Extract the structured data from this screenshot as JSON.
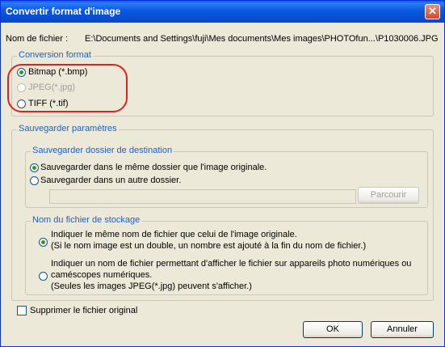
{
  "window": {
    "title": "Convertir format d'image",
    "close_symbol": "✕"
  },
  "file": {
    "label": "Nom de fichier :",
    "value": "E:\\Documents and Settings\\fuji\\Mes documents\\Mes images\\PHOTOfun...\\P1030006.JPG"
  },
  "conversion": {
    "legend": "Conversion format",
    "options": [
      {
        "label": "Bitmap (*.bmp)",
        "selected": true,
        "enabled": true
      },
      {
        "label": "JPEG(*.jpg)",
        "selected": false,
        "enabled": false
      },
      {
        "label": "TIFF (*.tif)",
        "selected": false,
        "enabled": true
      }
    ]
  },
  "save_params": {
    "legend": "Sauvegarder paramètres",
    "destination": {
      "legend": "Sauvegarder dossier de destination",
      "options": [
        {
          "label": "Sauvegarder dans le même dossier que l'image originale.",
          "selected": true
        },
        {
          "label": "Sauvegarder dans un autre dossier.",
          "selected": false
        }
      ],
      "folder_value": "",
      "browse_label": "Parcourir"
    },
    "storage_name": {
      "legend": "Nom du fichier de stockage",
      "option1_lines": [
        "Indiquer le même nom de fichier que celui de l'image originale.",
        "(Si le nom image est un double, un nombre est ajouté à la fin du nom de fichier.)"
      ],
      "option2_lines": [
        "Indiquer un nom de fichier permettant d'afficher le fichier sur appareils photo numériques ou",
        "caméscopes numériques.",
        "(Seules les images JPEG(*.jpg) peuvent s'afficher.)"
      ]
    }
  },
  "delete_original": {
    "label": "Supprimer le fichier original",
    "checked": false
  },
  "buttons": {
    "ok": "OK",
    "cancel": "Annuler"
  },
  "colors": {
    "titlebar": "#0a58e0",
    "legend": "#1a5fd1",
    "annotation": "#e02020",
    "dialog_bg": "#ece9d8"
  }
}
